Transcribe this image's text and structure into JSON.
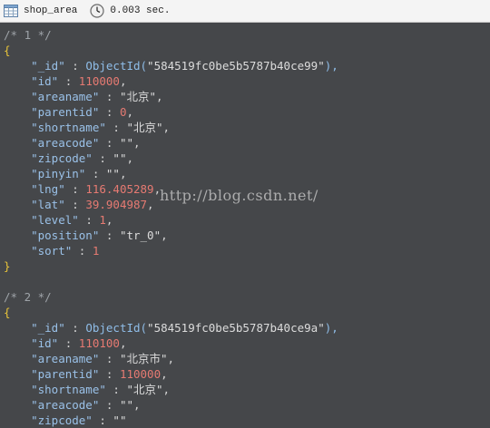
{
  "toolbar": {
    "collection": "shop_area",
    "elapsed": "0.003 sec."
  },
  "editor": {
    "lines": [
      [
        {
          "t": "/* 1 */",
          "c": "cmt"
        }
      ],
      [
        {
          "t": "{",
          "c": "br"
        }
      ],
      [
        {
          "t": "    \"_id\"",
          "c": "key"
        },
        {
          "t": " : ",
          "c": "pun"
        },
        {
          "t": "ObjectId(",
          "c": "fn"
        },
        {
          "t": "\"584519fc0be5b5787b40ce99\"",
          "c": "str"
        },
        {
          "t": "),",
          "c": "fn"
        }
      ],
      [
        {
          "t": "    \"id\"",
          "c": "key"
        },
        {
          "t": " : ",
          "c": "pun"
        },
        {
          "t": "110000",
          "c": "num"
        },
        {
          "t": ",",
          "c": "pun"
        }
      ],
      [
        {
          "t": "    \"areaname\"",
          "c": "key"
        },
        {
          "t": " : ",
          "c": "pun"
        },
        {
          "t": "\"北京\"",
          "c": "str"
        },
        {
          "t": ",",
          "c": "pun"
        }
      ],
      [
        {
          "t": "    \"parentid\"",
          "c": "key"
        },
        {
          "t": " : ",
          "c": "pun"
        },
        {
          "t": "0",
          "c": "num"
        },
        {
          "t": ",",
          "c": "pun"
        }
      ],
      [
        {
          "t": "    \"shortname\"",
          "c": "key"
        },
        {
          "t": " : ",
          "c": "pun"
        },
        {
          "t": "\"北京\"",
          "c": "str"
        },
        {
          "t": ",",
          "c": "pun"
        }
      ],
      [
        {
          "t": "    \"areacode\"",
          "c": "key"
        },
        {
          "t": " : ",
          "c": "pun"
        },
        {
          "t": "\"\"",
          "c": "str"
        },
        {
          "t": ",",
          "c": "pun"
        }
      ],
      [
        {
          "t": "    \"zipcode\"",
          "c": "key"
        },
        {
          "t": " : ",
          "c": "pun"
        },
        {
          "t": "\"\"",
          "c": "str"
        },
        {
          "t": ",",
          "c": "pun"
        }
      ],
      [
        {
          "t": "    \"pinyin\"",
          "c": "key"
        },
        {
          "t": " : ",
          "c": "pun"
        },
        {
          "t": "\"\"",
          "c": "str"
        },
        {
          "t": ",",
          "c": "pun"
        }
      ],
      [
        {
          "t": "    \"lng\"",
          "c": "key"
        },
        {
          "t": " : ",
          "c": "pun"
        },
        {
          "t": "116.405289",
          "c": "num"
        },
        {
          "t": ",",
          "c": "pun"
        }
      ],
      [
        {
          "t": "    \"lat\"",
          "c": "key"
        },
        {
          "t": " : ",
          "c": "pun"
        },
        {
          "t": "39.904987",
          "c": "num"
        },
        {
          "t": ",",
          "c": "pun"
        }
      ],
      [
        {
          "t": "    \"level\"",
          "c": "key"
        },
        {
          "t": " : ",
          "c": "pun"
        },
        {
          "t": "1",
          "c": "num"
        },
        {
          "t": ",",
          "c": "pun"
        }
      ],
      [
        {
          "t": "    \"position\"",
          "c": "key"
        },
        {
          "t": " : ",
          "c": "pun"
        },
        {
          "t": "\"tr_0\"",
          "c": "str"
        },
        {
          "t": ",",
          "c": "pun"
        }
      ],
      [
        {
          "t": "    \"sort\"",
          "c": "key"
        },
        {
          "t": " : ",
          "c": "pun"
        },
        {
          "t": "1",
          "c": "num"
        }
      ],
      [
        {
          "t": "}",
          "c": "br"
        }
      ],
      [
        {
          "t": "",
          "c": "pun"
        }
      ],
      [
        {
          "t": "/* 2 */",
          "c": "cmt"
        }
      ],
      [
        {
          "t": "{",
          "c": "br"
        }
      ],
      [
        {
          "t": "    \"_id\"",
          "c": "key"
        },
        {
          "t": " : ",
          "c": "pun"
        },
        {
          "t": "ObjectId(",
          "c": "fn"
        },
        {
          "t": "\"584519fc0be5b5787b40ce9a\"",
          "c": "str"
        },
        {
          "t": "),",
          "c": "fn"
        }
      ],
      [
        {
          "t": "    \"id\"",
          "c": "key"
        },
        {
          "t": " : ",
          "c": "pun"
        },
        {
          "t": "110100",
          "c": "num"
        },
        {
          "t": ",",
          "c": "pun"
        }
      ],
      [
        {
          "t": "    \"areaname\"",
          "c": "key"
        },
        {
          "t": " : ",
          "c": "pun"
        },
        {
          "t": "\"北京市\"",
          "c": "str"
        },
        {
          "t": ",",
          "c": "pun"
        }
      ],
      [
        {
          "t": "    \"parentid\"",
          "c": "key"
        },
        {
          "t": " : ",
          "c": "pun"
        },
        {
          "t": "110000",
          "c": "num"
        },
        {
          "t": ",",
          "c": "pun"
        }
      ],
      [
        {
          "t": "    \"shortname\"",
          "c": "key"
        },
        {
          "t": " : ",
          "c": "pun"
        },
        {
          "t": "\"北京\"",
          "c": "str"
        },
        {
          "t": ",",
          "c": "pun"
        }
      ],
      [
        {
          "t": "    \"areacode\"",
          "c": "key"
        },
        {
          "t": " : ",
          "c": "pun"
        },
        {
          "t": "\"\"",
          "c": "str"
        },
        {
          "t": ",",
          "c": "pun"
        }
      ],
      [
        {
          "t": "    \"zipcode\"",
          "c": "key"
        },
        {
          "t": " : ",
          "c": "pun"
        },
        {
          "t": "\"\"",
          "c": "str"
        }
      ]
    ]
  },
  "watermark": "http://blog.csdn.net/"
}
